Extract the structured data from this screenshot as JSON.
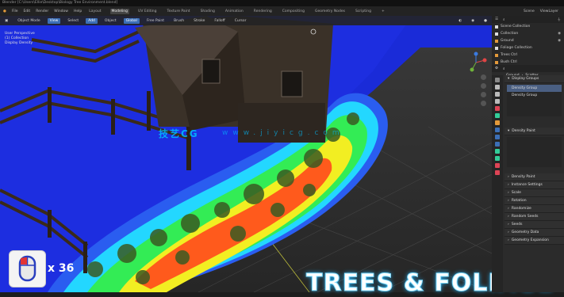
{
  "titlebar": {
    "text": "Blender [C:\\Users\\Ellie\\Desktop\\Biology Tree Environment.blend]"
  },
  "menubar": {
    "menus": [
      "File",
      "Edit",
      "Render",
      "Window",
      "Help"
    ],
    "workspaces": [
      {
        "label": "Layout",
        "active": false
      },
      {
        "label": "Modeling",
        "active": true
      },
      {
        "label": "UV Editing",
        "active": false
      },
      {
        "label": "Texture Paint",
        "active": false
      },
      {
        "label": "Shading",
        "active": false
      },
      {
        "label": "Animation",
        "active": false
      },
      {
        "label": "Rendering",
        "active": false
      },
      {
        "label": "Compositing",
        "active": false
      },
      {
        "label": "Geometry Nodes",
        "active": false
      },
      {
        "label": "Scripting",
        "active": false
      }
    ],
    "scene": "Scene",
    "view_layer": "ViewLayer"
  },
  "viewport_header": {
    "mode": "Object Mode",
    "items": [
      "View",
      "Select",
      "Add",
      "Object"
    ],
    "transform": "Global",
    "snap": "Free Paint",
    "tool_items": [
      "Brush",
      "Stroke",
      "Falloff",
      "Cursor"
    ]
  },
  "viewport_overlay": {
    "lines": [
      "User Perspective",
      "(1) Collection",
      "Display Density"
    ]
  },
  "watermark": {
    "brand": "技艺CG",
    "url": "www.jiyicg.com"
  },
  "badge": {
    "count": "x 36"
  },
  "banner": {
    "text": "TREES & FOLIAGE"
  },
  "outliner": {
    "search": "",
    "rows": [
      {
        "label": "Scene Collection",
        "icon": "collection-icon"
      },
      {
        "label": "Collection",
        "icon": "collection-icon"
      },
      {
        "label": "Ground",
        "icon": "mesh-icon"
      },
      {
        "label": "Foliage Collection",
        "icon": "collection-icon"
      },
      {
        "label": "Trees Ctrl",
        "icon": "object-icon"
      },
      {
        "label": "Bush Ctrl",
        "icon": "object-icon"
      },
      {
        "label": "Grass",
        "icon": "object-icon"
      }
    ]
  },
  "properties": {
    "object": "Ground",
    "modifier": "Scatter",
    "sections": [
      {
        "label": "Display Groups",
        "open": true
      },
      {
        "label": "Density Paint",
        "open": true
      },
      {
        "label": "Density Paint",
        "open": false
      },
      {
        "label": "Instance Settings",
        "open": false
      },
      {
        "label": "Scale",
        "open": false
      },
      {
        "label": "Rotation",
        "open": false
      },
      {
        "label": "Randomize",
        "open": false
      },
      {
        "label": "Random Seeds",
        "open": false
      },
      {
        "label": "Seeds",
        "open": false
      },
      {
        "label": "Geometry Data",
        "open": false
      },
      {
        "label": "Geometry Expansion",
        "open": false
      }
    ],
    "group_list": [
      "Density Group",
      "Density Group"
    ],
    "colors": {
      "accent": "#3c6fb6",
      "orange": "#e39a3a",
      "panel": "#303030"
    }
  },
  "heatmap": {
    "type": "weight-paint",
    "colors": [
      "#1a3df0",
      "#22e0ff",
      "#2ef05a",
      "#f3f01c",
      "#ff3a1c"
    ]
  }
}
